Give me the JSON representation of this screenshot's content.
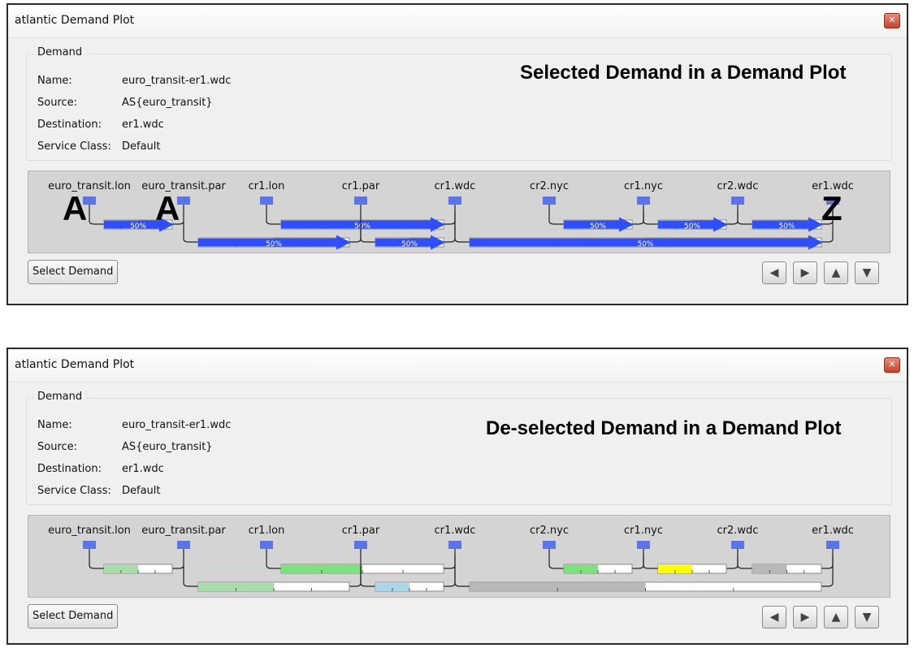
{
  "window_title": "atlantic Demand Plot",
  "group_label": "Demand",
  "fields": [
    {
      "label": "Name:",
      "value": "euro_transit-er1.wdc"
    },
    {
      "label": "Source:",
      "value": "AS{euro_transit}"
    },
    {
      "label": "Destination:",
      "value": "er1.wdc"
    },
    {
      "label": "Service Class:",
      "value": "Default"
    }
  ],
  "select_button": "Select Demand",
  "nav_buttons": [
    {
      "name": "nav-left",
      "icon": "arrow-left-icon",
      "glyph": "◀"
    },
    {
      "name": "nav-right",
      "icon": "arrow-right-icon",
      "glyph": "▶"
    },
    {
      "name": "nav-up",
      "icon": "arrow-up-icon",
      "glyph": "▲"
    },
    {
      "name": "nav-down",
      "icon": "arrow-down-icon",
      "glyph": "▼"
    }
  ],
  "nodes": [
    "euro_transit.lon",
    "euro_transit.par",
    "cr1.lon",
    "cr1.par",
    "cr1.wdc",
    "cr2.nyc",
    "cr1.nyc",
    "cr2.wdc",
    "er1.wdc"
  ],
  "windows": [
    {
      "overlay_text": "Selected Demand in a Demand Plot",
      "selected": true,
      "markers": {
        "a1": "A",
        "a2": "A",
        "z": "Z"
      }
    },
    {
      "overlay_text": "De-selected Demand in a Demand Plot",
      "selected": false
    }
  ],
  "links": [
    {
      "row": 1,
      "from": 0,
      "to": 1,
      "util_pct": 50,
      "color": "#a8dca8"
    },
    {
      "row": 1,
      "from": 2,
      "to": 4,
      "util_pct": 50,
      "color": "#7ce37c"
    },
    {
      "row": 1,
      "from": 5,
      "to": 6,
      "util_pct": 50,
      "color": "#7ce37c"
    },
    {
      "row": 1,
      "from": 6,
      "to": 7,
      "util_pct": 50,
      "color": "#ffff00"
    },
    {
      "row": 1,
      "from": 7,
      "to": 8,
      "util_pct": 50,
      "color": "#b8b8b8"
    },
    {
      "row": 2,
      "from": 1,
      "to": 3,
      "util_pct": 50,
      "color": "#a8dca8"
    },
    {
      "row": 2,
      "from": 3,
      "to": 4,
      "util_pct": 50,
      "color": "#a8d8e8"
    },
    {
      "row": 2,
      "from": 4,
      "to": 8,
      "util_pct": 50,
      "color": "#b8b8b8"
    }
  ],
  "colors": {
    "selected_arrow": "#2f4fff",
    "node_square": "#5b74e8",
    "titlebar": "#ffffff",
    "window_bg": "#f0f0f0",
    "plot_bg": "#d4d4d4",
    "close_button": "#d4573c"
  }
}
